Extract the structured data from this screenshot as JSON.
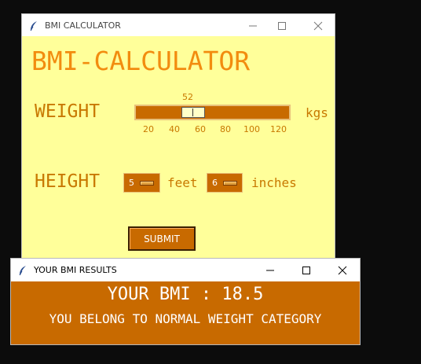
{
  "main_window": {
    "title": "BMI CALCULATOR",
    "app_title": "BMI-CALCULATOR",
    "weight_label": "WEIGHT",
    "weight_value": "52",
    "weight_ticks": [
      "20",
      "40",
      "60",
      "80",
      "100",
      "120"
    ],
    "weight_unit": "kgs",
    "height_label": "HEIGHT",
    "feet_value": "5",
    "feet_unit": "feet",
    "inches_value": "6",
    "inches_unit": "inches",
    "submit_label": "SUBMIT"
  },
  "results_window": {
    "title": "YOUR BMI RESULTS",
    "bmi_text": "YOUR BMI : 18.5",
    "category_text": "YOU BELONG TO NORMAL WEIGHT CATEGORY"
  },
  "colors": {
    "main_bg": "#ffff9a",
    "accent": "#c86a00",
    "title_orange": "#f28c0f",
    "label_text": "#c87800"
  },
  "icons": [
    "feather-icon",
    "minimize-icon",
    "maximize-icon",
    "close-icon"
  ]
}
